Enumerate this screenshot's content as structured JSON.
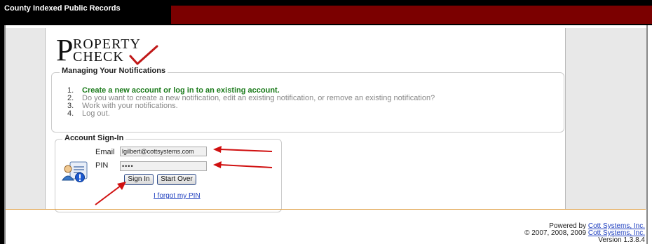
{
  "header": {
    "title": "County Indexed Public Records"
  },
  "logo": {
    "big_letter": "P",
    "line1": "ROPERTY",
    "line2": "CHECK"
  },
  "notifications": {
    "legend": "Managing Your Notifications",
    "steps": [
      {
        "num": "1.",
        "text": "Create a new account or log in to an existing account."
      },
      {
        "num": "2.",
        "text": "Do you want to create a new notification, edit an existing notification, or remove an existing notification?"
      },
      {
        "num": "3.",
        "text": "Work with your notifications."
      },
      {
        "num": "4.",
        "text": "Log out."
      }
    ]
  },
  "signin": {
    "legend": "Account Sign-In",
    "email_label": "Email",
    "email_value": "lgilbert@cottsystems.com",
    "pin_label": "PIN",
    "pin_value": "••••",
    "sign_in_label": "Sign In",
    "start_over_label": "Start Over",
    "forgot_label": "I forgot my PIN"
  },
  "footer": {
    "powered_prefix": "Powered by ",
    "company": "Cott Systems, Inc.",
    "copyright_prefix": "© 2007, 2008, 2009 ",
    "version": "Version 1.3.8.4"
  },
  "colors": {
    "header_red": "#7b0000",
    "active_step": "#1a7a1a",
    "arrow": "#d01010",
    "link": "#1f3fbf"
  },
  "icons": [
    "user-card-icon",
    "checkmark-icon"
  ]
}
